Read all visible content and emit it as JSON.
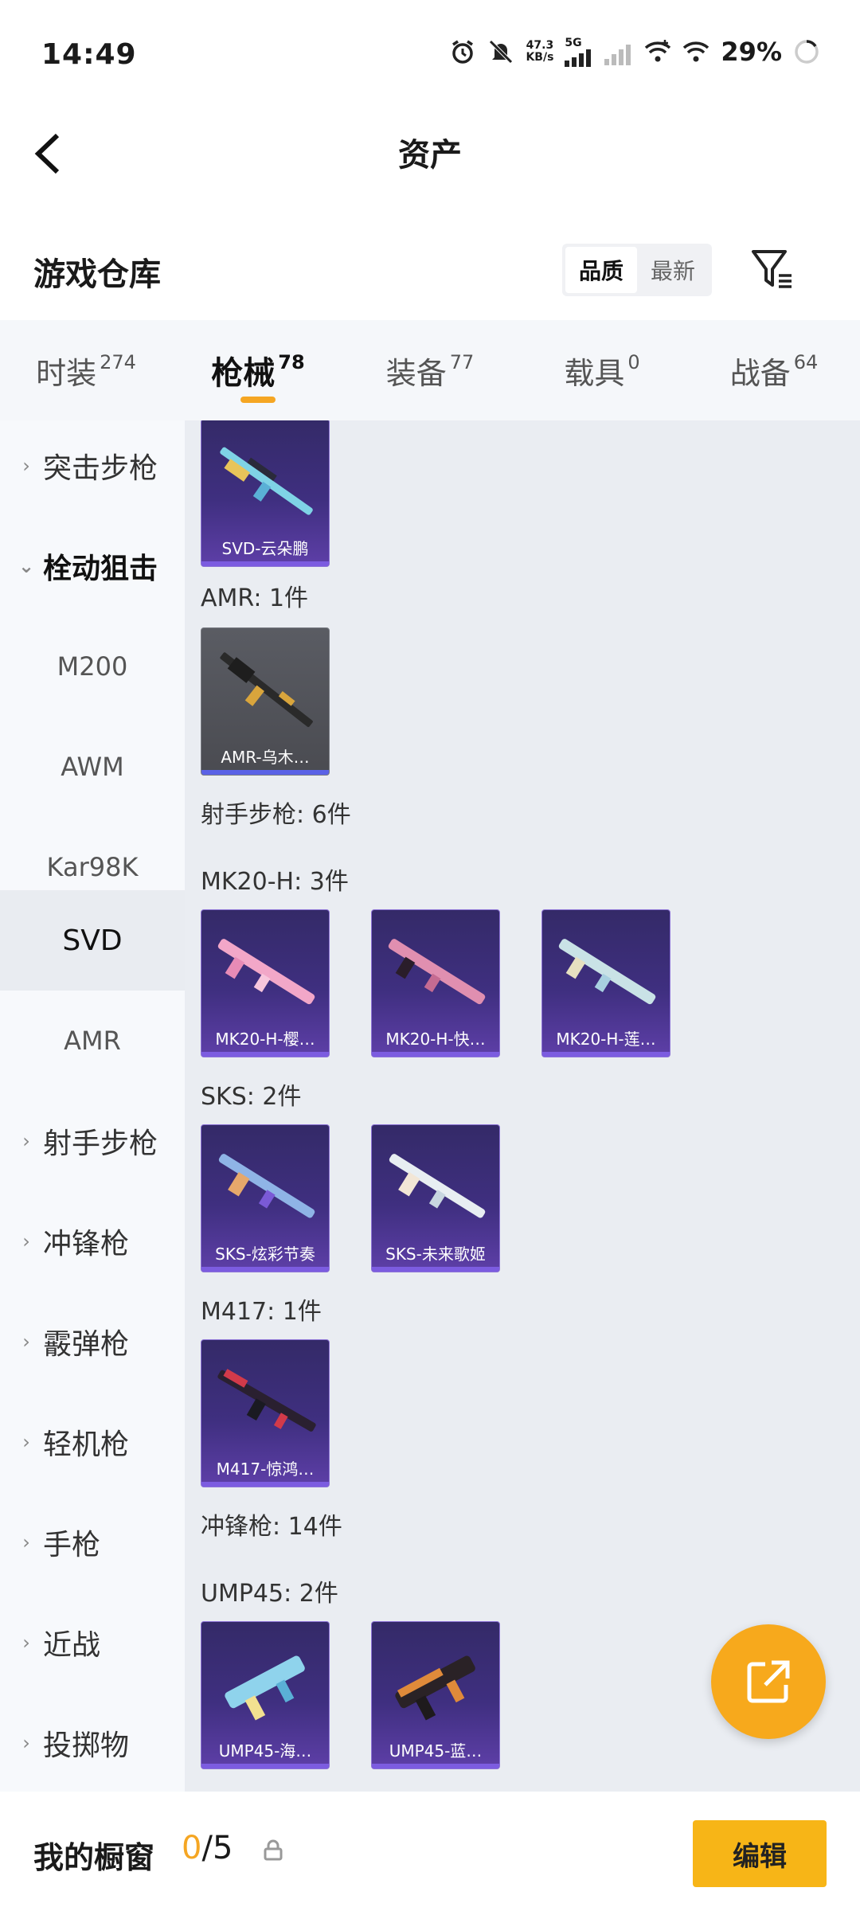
{
  "status_bar": {
    "time": "14:49",
    "net_speed_value": "47.3",
    "net_speed_unit": "KB/s",
    "network": "5G",
    "battery": "29%"
  },
  "nav": {
    "title": "资产"
  },
  "section": {
    "title": "游戏仓库",
    "sort_options": [
      "品质",
      "最新"
    ],
    "sort_active": "品质"
  },
  "tabs": [
    {
      "label": "时装",
      "count": "274"
    },
    {
      "label": "枪械",
      "count": "78"
    },
    {
      "label": "装备",
      "count": "77"
    },
    {
      "label": "载具",
      "count": "0"
    },
    {
      "label": "战备",
      "count": "64"
    }
  ],
  "sidebar": {
    "items": [
      {
        "label": "突击步枪",
        "type": "group"
      },
      {
        "label": "栓动狙击",
        "type": "group-expanded"
      },
      {
        "label": "M200",
        "type": "sub"
      },
      {
        "label": "AWM",
        "type": "sub"
      },
      {
        "label": "Kar98K",
        "type": "sub"
      },
      {
        "label": "SVD",
        "type": "sub-selected"
      },
      {
        "label": "AMR",
        "type": "sub"
      },
      {
        "label": "射手步枪",
        "type": "group"
      },
      {
        "label": "冲锋枪",
        "type": "group"
      },
      {
        "label": "霰弹枪",
        "type": "group"
      },
      {
        "label": "轻机枪",
        "type": "group"
      },
      {
        "label": "手枪",
        "type": "group"
      },
      {
        "label": "近战",
        "type": "group"
      },
      {
        "label": "投掷物",
        "type": "group"
      }
    ]
  },
  "content": {
    "labels": [
      "AMR: 1件",
      "射手步枪: 6件",
      "MK20-H: 3件",
      "SKS: 2件",
      "M417: 1件",
      "冲锋枪: 14件",
      "UMP45: 2件"
    ],
    "cards": [
      {
        "name": "SVD-云朵鹏",
        "accent": "#7fd3e6"
      },
      {
        "name": "AMR-乌木…",
        "accent": "#d9a53c"
      },
      {
        "name": "MK20-H-樱…",
        "accent": "#f2a7c8"
      },
      {
        "name": "MK20-H-快…",
        "accent": "#e08fb0"
      },
      {
        "name": "MK20-H-莲…",
        "accent": "#c9e2e6"
      },
      {
        "name": "SKS-炫彩节奏",
        "accent": "#8fb4e6"
      },
      {
        "name": "SKS-未来歌姬",
        "accent": "#e8eef2"
      },
      {
        "name": "M417-惊鸿…",
        "accent": "#d23a4a"
      },
      {
        "name": "UMP45-海…",
        "accent": "#8fd3ec"
      },
      {
        "name": "UMP45-蓝…",
        "accent": "#e08a3a"
      }
    ]
  },
  "bottom": {
    "label": "我的橱窗",
    "current": "0",
    "separator": "/",
    "total": "5",
    "edit": "编辑"
  },
  "colors": {
    "accent": "#f5a623",
    "card_bg": "#3f2f80",
    "content_bg": "#eaedf2"
  }
}
